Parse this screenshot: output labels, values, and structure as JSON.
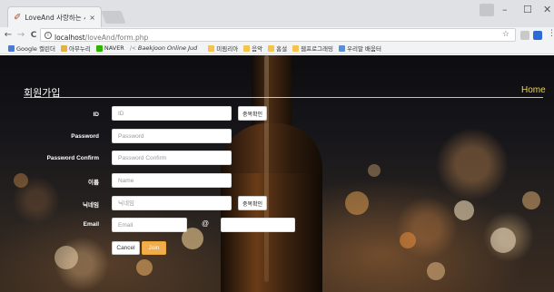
{
  "browser": {
    "tab_title": "LoveAnd 사랑하는 사람",
    "tab_close": "×",
    "window_controls": [
      "–",
      "☐",
      "✕"
    ],
    "url_host": "localhost",
    "url_path": "/loveAnd/form.php",
    "nav": [
      "←",
      "→",
      "C"
    ],
    "bookmarks": [
      {
        "label": "Google 캘린더",
        "color": "#4a7bd6"
      },
      {
        "label": "아무누리",
        "color": "#e3b341"
      },
      {
        "label": "NAVER",
        "color": "#2db400"
      },
      {
        "label": "Baekjoon Online Jud",
        "color": "#bbbbbb"
      },
      {
        "label": "미림리아",
        "color": "#f3c44e"
      },
      {
        "label": "음악",
        "color": "#f3c44e"
      },
      {
        "label": "홈설",
        "color": "#f3c44e"
      },
      {
        "label": "웹프로그래밍",
        "color": "#f3c44e"
      },
      {
        "label": "우리말 배움터",
        "color": "#5b8fd6"
      }
    ]
  },
  "page": {
    "title": "회원가입",
    "home_link": "Home",
    "colors": {
      "accent": "#f0d24a",
      "join_button": "#f0ad4e"
    },
    "fields": {
      "id": {
        "label": "ID",
        "placeholder": "ID",
        "value": ""
      },
      "password": {
        "label": "Password",
        "placeholder": "Password",
        "value": ""
      },
      "password_confirm": {
        "label": "Password Confirm",
        "placeholder": "Password Confirm",
        "value": ""
      },
      "name": {
        "label": "이름",
        "placeholder": "Name",
        "value": ""
      },
      "nickname": {
        "label": "닉네임",
        "placeholder": "닉네임",
        "value": ""
      },
      "email": {
        "label": "Email",
        "placeholder": "Email",
        "value": "",
        "at": "@",
        "domain_value": ""
      }
    },
    "duplicate_check_label": "중복확인",
    "cancel_label": "Cancel",
    "join_label": "Join"
  }
}
